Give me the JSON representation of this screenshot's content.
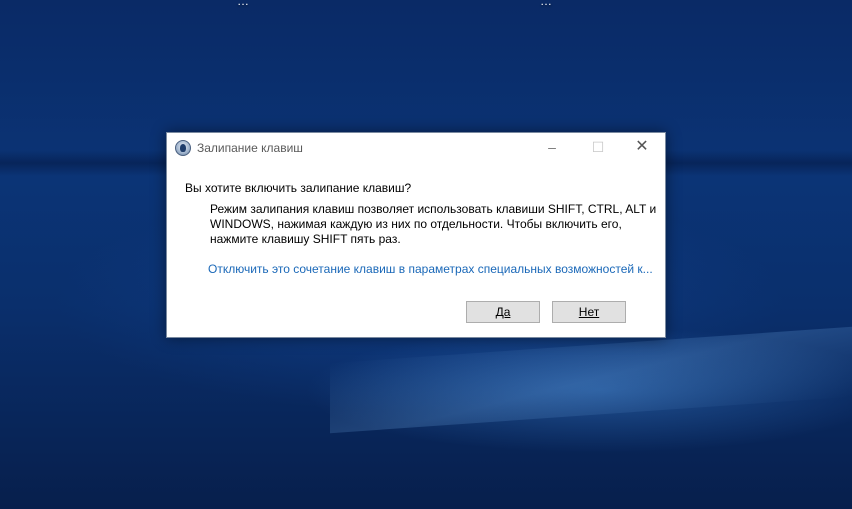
{
  "desktop": {
    "icons": [
      {
        "label": "…"
      },
      {
        "label": "…"
      }
    ]
  },
  "dialog": {
    "title": "Залипание клавиш",
    "controls": {
      "minimize": "–",
      "maximize": "☐",
      "close": "✕"
    },
    "question": "Вы хотите включить залипание клавиш?",
    "description": "Режим залипания клавиш позволяет использовать клавиши SHIFT, CTRL, ALT и WINDOWS, нажимая каждую из них по отдельности. Чтобы включить его, нажмите клавишу SHIFT пять раз.",
    "link": "Отключить это сочетание клавиш в параметрах специальных возможностей к...",
    "buttons": {
      "yes": "Да",
      "no": "Нет"
    }
  },
  "colors": {
    "link": "#1a68b8",
    "desktop_bg": "#0b3476",
    "button_bg": "#e1e1e1"
  }
}
